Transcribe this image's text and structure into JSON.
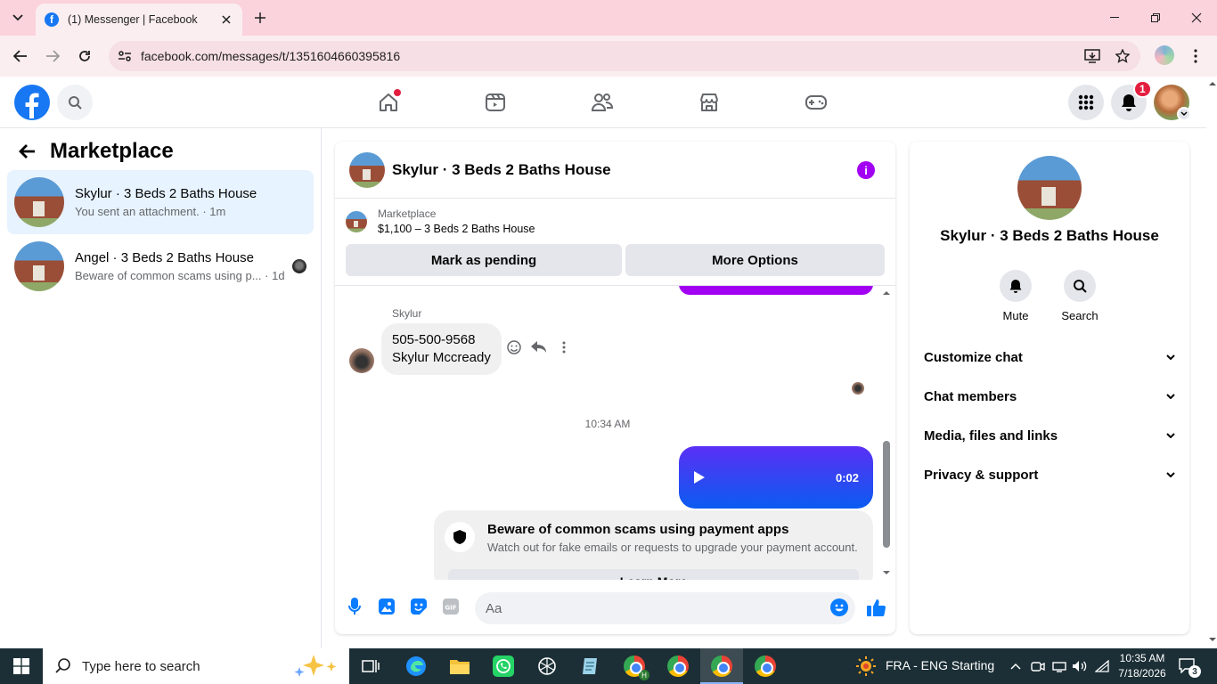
{
  "browser": {
    "tab_title": "(1) Messenger | Facebook",
    "url": "facebook.com/messages/t/1351604660395816"
  },
  "fb_header": {
    "notification_count": "1",
    "accent_color": "#1877f2"
  },
  "left_panel": {
    "title": "Marketplace",
    "conversations": [
      {
        "name": "Skylur · 3 Beds 2 Baths House",
        "preview": "You sent an attachment. · 1m",
        "active": true
      },
      {
        "name": "Angel · 3 Beds 2 Baths House",
        "preview": "Beware of common scams using p... · 1d",
        "active": false
      }
    ]
  },
  "chat": {
    "title": "Skylur · 3 Beds 2 Baths House",
    "marketplace_label": "Marketplace",
    "listing": "$1,100 – 3 Beds 2 Baths House",
    "mark_pending": "Mark as pending",
    "more_options": "More Options",
    "sender_name": "Skylur",
    "incoming_line1": "505-500-9568",
    "incoming_line2": "Skylur Mccready",
    "timestamp": "10:34 AM",
    "audio_duration": "0:02",
    "scam_title": "Beware of common scams using payment apps",
    "scam_sub": "Watch out for fake emails or requests to upgrade your payment account.",
    "learn_more": "Learn More",
    "composer_placeholder": "Aa",
    "bubble_color": "#0a5cf0"
  },
  "right_panel": {
    "name": "Skylur · 3 Beds 2 Baths House",
    "mute": "Mute",
    "search": "Search",
    "sections": [
      "Customize chat",
      "Chat members",
      "Media, files and links",
      "Privacy & support"
    ]
  },
  "taskbar": {
    "search_placeholder": "Type here to search",
    "weather_text": "FRA - ENG Starting",
    "time": "10:35 AM",
    "date": "7/18/2026",
    "notif_count": "3"
  }
}
